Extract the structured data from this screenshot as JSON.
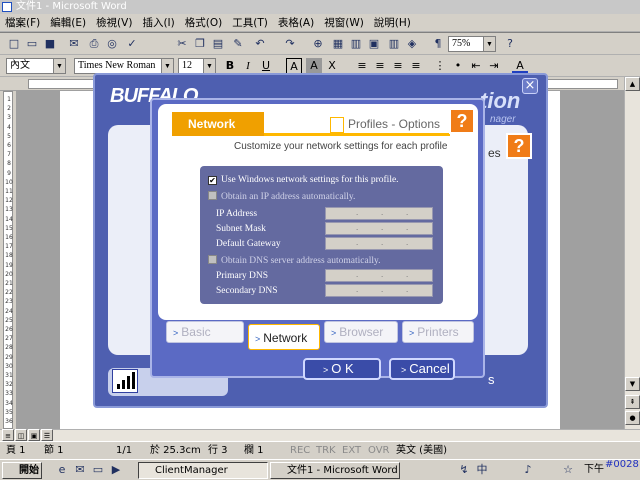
{
  "window": {
    "title": "文件1 - Microsoft Word"
  },
  "menu": [
    "檔案(F)",
    "編輯(E)",
    "檢視(V)",
    "插入(I)",
    "格式(O)",
    "工具(T)",
    "表格(A)",
    "視窗(W)",
    "說明(H)"
  ],
  "toolbar": {
    "zoom": "75%"
  },
  "format": {
    "style": "內文",
    "font": "Times New Roman",
    "size": "12"
  },
  "ruler": {
    "vticks": [
      "1",
      "2",
      "3",
      "4",
      "5",
      "6",
      "7",
      "8",
      "9",
      "10",
      "11",
      "12",
      "13",
      "14",
      "15",
      "16",
      "17",
      "18",
      "19",
      "20",
      "21",
      "22",
      "23",
      "24",
      "25",
      "26",
      "27",
      "28",
      "29",
      "30",
      "31",
      "32",
      "33",
      "34",
      "35",
      "36"
    ]
  },
  "app": {
    "logo": "BUFFALO",
    "bg_right_text": "tion",
    "bg_right_sub": "nager",
    "bg_profiles_text": "es",
    "bg_bottom_text": "s",
    "help_label": "?"
  },
  "dialog": {
    "tab_label": "Network",
    "header_title": "Profiles - Options",
    "subtitle": "Customize your network settings for each profile",
    "help_label": "?",
    "close_label": "×",
    "use_windows": {
      "label": "Use Windows network settings for this profile.",
      "checked": "✔"
    },
    "obtain_ip": {
      "label": "Obtain an IP address automatically."
    },
    "ip_fields": [
      {
        "label": "IP Address"
      },
      {
        "label": "Subnet Mask"
      },
      {
        "label": "Default Gateway"
      }
    ],
    "obtain_dns": {
      "label": "Obtain DNS server address automatically."
    },
    "dns_fields": [
      {
        "label": "Primary DNS"
      },
      {
        "label": "Secondary DNS"
      }
    ],
    "tabs": {
      "basic": "Basic",
      "network": "Network",
      "browser": "Browser",
      "printers": "Printers"
    },
    "ok_label": "O K",
    "cancel_label": "Cancel"
  },
  "status": {
    "page": "頁 1",
    "section": "節 1",
    "pages": "1/1",
    "position": "於 25.3cm",
    "line": "行 3",
    "col": "欄 1",
    "rec": "REC",
    "trk": "TRK",
    "ext": "EXT",
    "ovr": "OVR",
    "lang": "英文 (美國)"
  },
  "taskbar": {
    "start": "開始",
    "tasks": [
      {
        "label": "ClientManager"
      },
      {
        "label": "文件1 - Microsoft Word"
      }
    ],
    "clock": "下午",
    "corner_text": "#0028"
  }
}
